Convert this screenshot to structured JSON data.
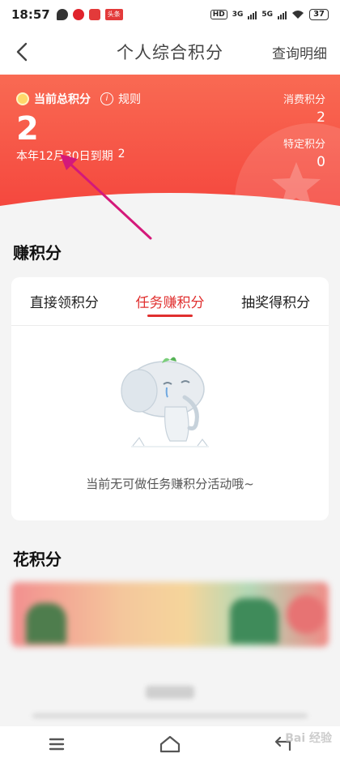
{
  "status_bar": {
    "time": "18:57",
    "badge": "头条",
    "network1": "HD",
    "network2": "3G",
    "network3": "5G",
    "battery": "37"
  },
  "header": {
    "title": "个人综合积分",
    "detail_link": "查询明细"
  },
  "points": {
    "total_label": "当前总积分",
    "rule_label": "规则",
    "total_value": "2",
    "expire_text": "本年12月30日到期",
    "expire_value": "2",
    "consume_label": "消费积分",
    "consume_value": "2",
    "special_label": "特定积分",
    "special_value": "0"
  },
  "earn": {
    "section_title": "赚积分",
    "tabs": [
      {
        "label": "直接领积分",
        "active": false
      },
      {
        "label": "任务赚积分",
        "active": true
      },
      {
        "label": "抽奖得积分",
        "active": false
      }
    ],
    "empty_text": "当前无可做任务赚积分活动哦~"
  },
  "spend": {
    "section_title": "花积分"
  },
  "watermark": "Bai 经验",
  "colors": {
    "accent": "#e0302f",
    "banner_top": "#f96a53",
    "banner_bottom": "#f4443c",
    "annotation_arrow": "#d4197a"
  }
}
